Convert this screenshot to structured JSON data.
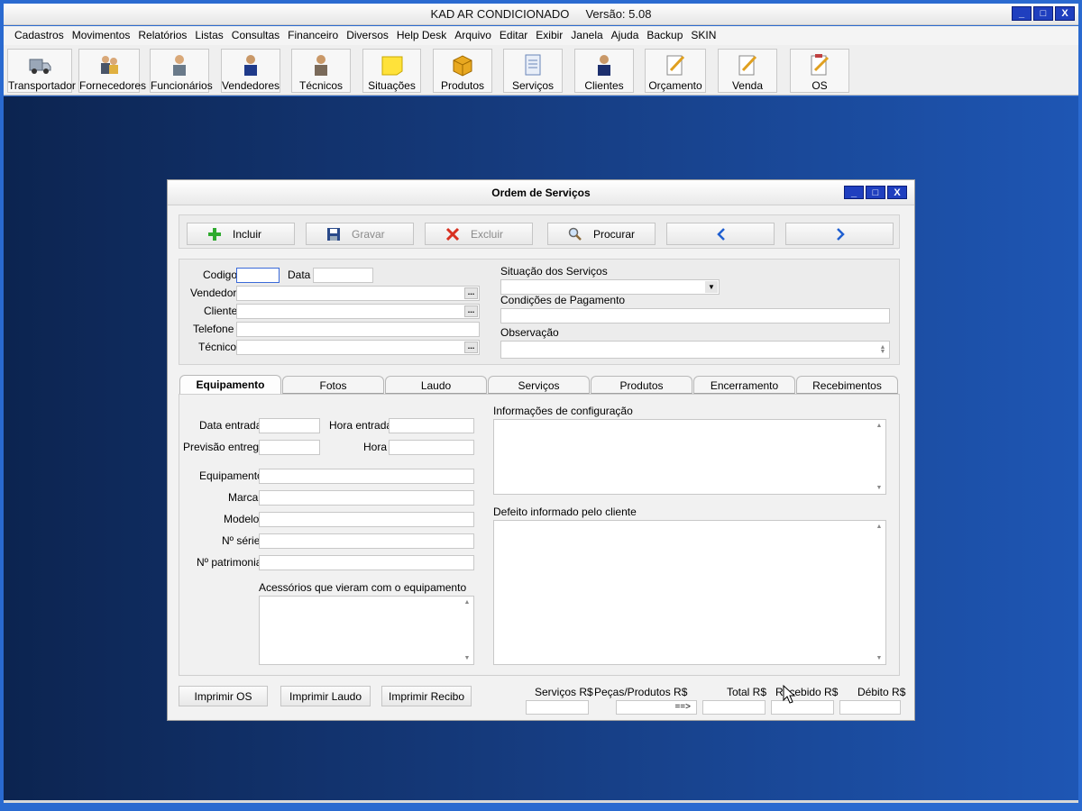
{
  "app": {
    "title": "KAD AR CONDICIONADO     Versão: 5.08",
    "window_buttons": [
      "_",
      "□",
      "X"
    ]
  },
  "menu": [
    "Cadastros",
    "Movimentos",
    "Relatórios",
    "Listas",
    "Consultas",
    "Financeiro",
    "Diversos",
    "Help Desk",
    "Arquivo",
    "Editar",
    "Exibir",
    "Janela",
    "Ajuda",
    "Backup",
    "SKIN"
  ],
  "toolbar": [
    {
      "label": "Transportador",
      "icon": "truck-icon"
    },
    {
      "label": "Fornecedores",
      "icon": "suppliers-icon"
    },
    {
      "label": "Funcionários",
      "icon": "employee-icon"
    },
    {
      "label": "Vendedores",
      "icon": "seller-icon"
    },
    {
      "label": "Técnicos",
      "icon": "technician-icon"
    },
    {
      "label": "Situações",
      "icon": "sticky-note-icon"
    },
    {
      "label": "Produtos",
      "icon": "box-icon"
    },
    {
      "label": "Serviços",
      "icon": "document-icon"
    },
    {
      "label": "Clientes",
      "icon": "client-icon"
    },
    {
      "label": "Orçamento",
      "icon": "quote-icon"
    },
    {
      "label": "Venda",
      "icon": "sale-icon"
    },
    {
      "label": "OS",
      "icon": "clipboard-icon"
    }
  ],
  "child": {
    "title": "Ordem de Serviços",
    "actions": {
      "incluir": "Incluir",
      "gravar": "Gravar",
      "excluir": "Excluir",
      "procurar": "Procurar"
    },
    "header": {
      "codigo_label": "Codigo",
      "data_label": "Data",
      "vendedor_label": "Vendedor",
      "cliente_label": "Cliente",
      "telefone_label": "Telefone",
      "tecnico_label": "Técnico",
      "situacao_label": "Situação dos Serviços",
      "condicoes_label": "Condições de Pagamento",
      "observacao_label": "Observação",
      "ellipsis": "..."
    },
    "tabs": [
      "Equipamento",
      "Fotos",
      "Laudo",
      "Serviços",
      "Produtos",
      "Encerramento",
      "Recebimentos"
    ],
    "equipamento": {
      "data_entrada": "Data entrada",
      "hora_entrada": "Hora entrada",
      "previsao_entrega": "Previsão entrega",
      "hora": "Hora",
      "equipamento": "Equipamento",
      "marca": "Marca",
      "modelo": "Modelo",
      "n_serie": "Nº série",
      "n_patrimonial": "Nº patrimonial",
      "acessorios": "Acessórios que vieram com o equipamento",
      "info_config": "Informações de configuração",
      "defeito": "Defeito informado pelo cliente"
    },
    "footer": {
      "imprimir_os": "Imprimir OS",
      "imprimir_laudo": "Imprimir Laudo",
      "imprimir_recibo": "Imprimir Recibo",
      "servicos": "Serviços R$",
      "pecas": "Peças/Produtos R$",
      "arrow": "==>",
      "total": "Total R$",
      "recebido": "Recebido R$",
      "debito": "Débito R$"
    }
  },
  "colors": {
    "desktop_dark": "#0c2450",
    "desktop_light": "#1e56b4",
    "title_button": "#1f3fbf",
    "focus_border": "#3a6ad8"
  }
}
